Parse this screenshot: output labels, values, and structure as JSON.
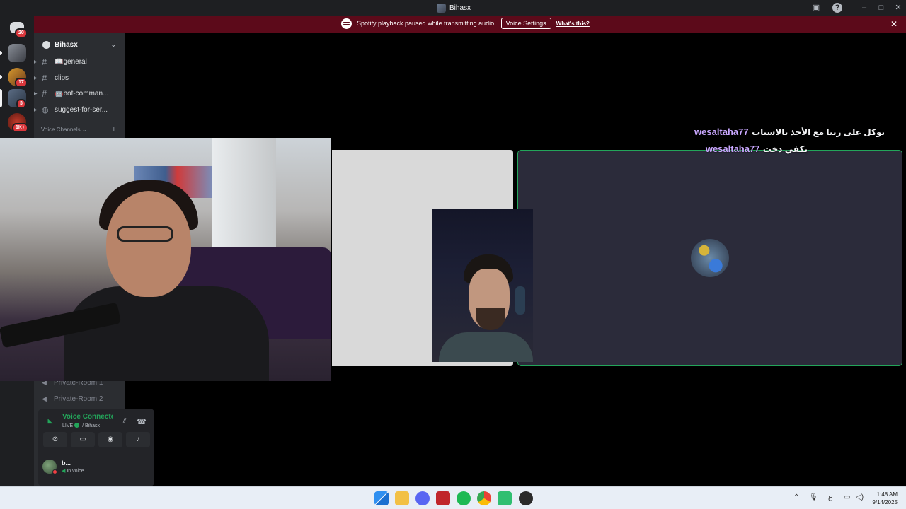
{
  "window": {
    "title": "Bihasx"
  },
  "notice": {
    "text": "Spotify playback paused while transmitting audio.",
    "button_label": "Voice Settings",
    "link_label": "What's this?"
  },
  "rail": {
    "badges": [
      "20",
      "17",
      "3",
      "1K+"
    ]
  },
  "sidebar": {
    "server_name": "Bihasx",
    "channels": [
      {
        "label": "📖general"
      },
      {
        "label": "clips"
      },
      {
        "label": "🤖bot-comman..."
      },
      {
        "label": "suggest-for-ser..."
      }
    ],
    "voice_header": "Voice Channels",
    "voice_channels": [
      {
        "label": "Private-Room 1"
      },
      {
        "label": "Private-Room 2"
      }
    ]
  },
  "voice_panel": {
    "status": "Voice Connected",
    "live_label": "LIVE",
    "server": "/ Bihasx",
    "user_name": "b...",
    "user_status": "In voice"
  },
  "chat": {
    "messages": [
      {
        "user": "wesaltaha77",
        "text": "توكل على ربنا مع الأخذ بالاسباب"
      },
      {
        "user": "wesaltaha77",
        "text": "بكفي دخت"
      }
    ]
  },
  "taskbar": {
    "tray_lang": "ع",
    "time": "1:48 AM",
    "date": "9/14/2025"
  },
  "colors": {
    "notice_bg": "#5c0a1a",
    "speaking_border": "#23a55a",
    "chat_username": "#c9a7ff"
  }
}
